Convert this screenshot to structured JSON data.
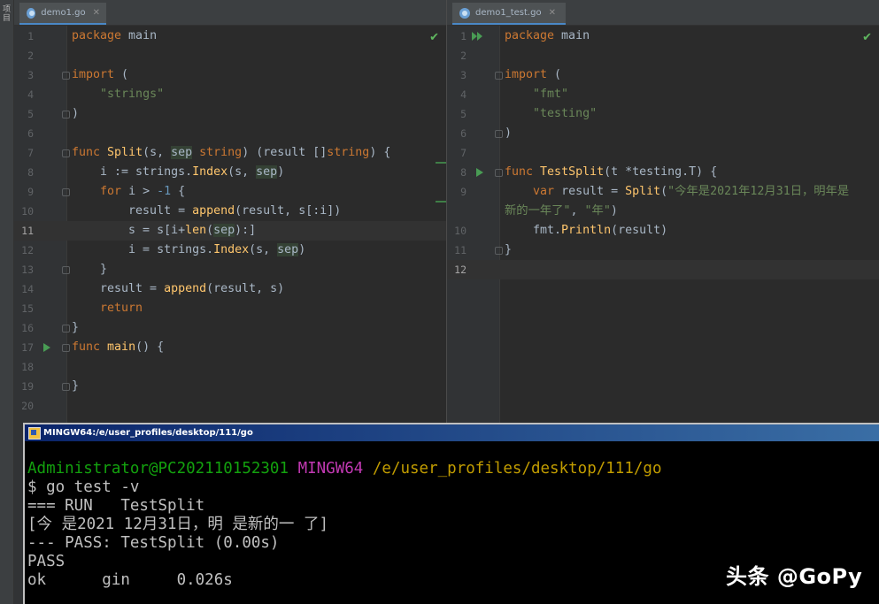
{
  "sidebar": {
    "project_tab_label": "项目"
  },
  "left_editor": {
    "tab": {
      "label": "demo1.go"
    },
    "lines": [
      {
        "n": "1",
        "html": "<span class=\"kw\">package</span> main"
      },
      {
        "n": "2",
        "html": ""
      },
      {
        "n": "3",
        "html": "<span class=\"kw\">import</span> ("
      },
      {
        "n": "4",
        "html": "    <span class=\"str\">\"strings\"</span>"
      },
      {
        "n": "5",
        "html": ")"
      },
      {
        "n": "6",
        "html": ""
      },
      {
        "n": "7",
        "html": "<span class=\"kw\">func</span> <span class=\"fn\">Split</span>(s, <span class=\"hl\">sep</span> <span class=\"kw\">string</span>) (result []<span class=\"kw\">string</span>) {"
      },
      {
        "n": "8",
        "html": "    i := strings.<span class=\"fn\">Index</span>(s, <span class=\"hl\">sep</span>)"
      },
      {
        "n": "9",
        "html": "    <span class=\"kw\">for</span> i > <span class=\"num\">-1</span> {"
      },
      {
        "n": "10",
        "html": "        result = <span class=\"fn\">append</span>(result, s[:i])"
      },
      {
        "n": "11",
        "html": "        s = s[i+<span class=\"fn\">len</span>(<span class=\"hl\">sep</span>):]"
      },
      {
        "n": "12",
        "html": "        i = strings.<span class=\"fn\">Index</span>(s, <span class=\"hl\">sep</span>)"
      },
      {
        "n": "13",
        "html": "    }"
      },
      {
        "n": "14",
        "html": "    result = <span class=\"fn\">append</span>(result, s)"
      },
      {
        "n": "15",
        "html": "    <span class=\"kw\">return</span>"
      },
      {
        "n": "16",
        "html": "}"
      },
      {
        "n": "17",
        "html": "<span class=\"kw\">func</span> <span class=\"fn\">main</span>() {"
      },
      {
        "n": "18",
        "html": ""
      },
      {
        "n": "19",
        "html": "}"
      },
      {
        "n": "20",
        "html": ""
      }
    ]
  },
  "right_editor": {
    "tab": {
      "label": "demo1_test.go"
    },
    "lines": [
      {
        "n": "1",
        "html": "<span class=\"kw\">package</span> main"
      },
      {
        "n": "2",
        "html": ""
      },
      {
        "n": "3",
        "html": "<span class=\"kw\">import</span> ("
      },
      {
        "n": "4",
        "html": "    <span class=\"str\">\"fmt\"</span>"
      },
      {
        "n": "5",
        "html": "    <span class=\"str\">\"testing\"</span>"
      },
      {
        "n": "6",
        "html": ")"
      },
      {
        "n": "7",
        "html": ""
      },
      {
        "n": "8",
        "html": "<span class=\"kw\">func</span> <span class=\"fn\">TestSplit</span>(t *testing.T) {"
      },
      {
        "n": "9",
        "html": "    <span class=\"kw\">var</span> result = <span class=\"fn\">Split</span>(<span class=\"str\">\"今年是2021年12月31日，明年是</span>"
      },
      {
        "n": "",
        "html": "<span class=\"str\">新的一年了\"</span>, <span class=\"str\">\"年\"</span>)"
      },
      {
        "n": "10",
        "html": "    fmt.<span class=\"fn\">Println</span>(result)"
      },
      {
        "n": "11",
        "html": "}"
      },
      {
        "n": "12",
        "html": ""
      }
    ]
  },
  "terminal": {
    "title": "MINGW64:/e/user_profiles/desktop/111/go",
    "prompt_user": "Administrator@PC202110152301",
    "prompt_env": "MINGW64",
    "prompt_path": "/e/user_profiles/desktop/111/go",
    "command": "$ go test -v",
    "out_run": "=== RUN   TestSplit",
    "out_result": "[今 是2021 12月31日，明 是新的一 了]",
    "out_pass_line": "--- PASS: TestSplit (0.00s)",
    "out_pass": "PASS",
    "out_ok": "ok      gin     0.026s"
  },
  "watermark": "头条 @GoPy"
}
